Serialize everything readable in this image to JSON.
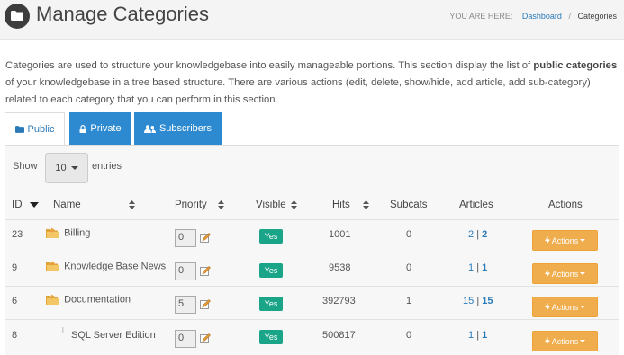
{
  "header": {
    "title": "Manage Categories",
    "breadcrumb": {
      "prefix": "YOU ARE HERE:",
      "link": "Dashboard",
      "separator": "/",
      "current": "Categories"
    }
  },
  "intro": {
    "part1": "Categories are used to structure your knowledgebase into easily manageable portions. This section display the list of ",
    "bold": "public categories",
    "part2": " of your knowledgebase in a tree based structure. There are various actions (edit, delete, show/hide, add article, add sub-category) related to each category that you can perform in this section."
  },
  "tabs": [
    {
      "label": "Public",
      "icon": "folder-icon",
      "active": true
    },
    {
      "label": "Private",
      "icon": "lock-icon",
      "active": false
    },
    {
      "label": "Subscribers",
      "icon": "users-icon",
      "active": false
    }
  ],
  "length_control": {
    "show": "Show",
    "value": "10",
    "entries": "entries"
  },
  "columns": {
    "id": "ID",
    "name": "Name",
    "priority": "Priority",
    "visible": "Visible",
    "hits": "Hits",
    "subcats": "Subcats",
    "articles": "Articles",
    "actions": "Actions"
  },
  "rows": [
    {
      "id": "23",
      "name": "Billing",
      "priority": "0",
      "visible": "Yes",
      "hits": "1001",
      "subcats": "0",
      "articles_a": "2",
      "articles_sep": "|",
      "articles_b": "2",
      "actions": "Actions"
    },
    {
      "id": "9",
      "name": "Knowledge Base News",
      "priority": "0",
      "visible": "Yes",
      "hits": "9538",
      "subcats": "0",
      "articles_a": "1",
      "articles_sep": "|",
      "articles_b": "1",
      "actions": "Actions"
    },
    {
      "id": "6",
      "name": "Documentation",
      "priority": "5",
      "visible": "Yes",
      "hits": "392793",
      "subcats": "1",
      "articles_a": "15",
      "articles_sep": "|",
      "articles_b": "15",
      "actions": "Actions"
    },
    {
      "id": "8",
      "name": "SQL Server Edition",
      "prefix": "└",
      "priority": "0",
      "visible": "Yes",
      "hits": "500817",
      "subcats": "0",
      "articles_a": "1",
      "articles_sep": "|",
      "articles_b": "1",
      "actions": "Actions"
    }
  ],
  "colors": {
    "accent": "#2d8ad1",
    "visible_badge": "#1aa589",
    "actions_button": "#f0ad4e"
  }
}
